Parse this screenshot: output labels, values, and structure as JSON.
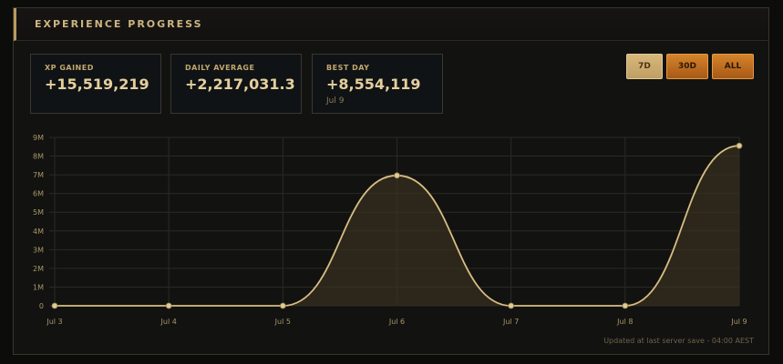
{
  "panel": {
    "title": "EXPERIENCE PROGRESS"
  },
  "stats": [
    {
      "label": "XP GAINED",
      "value": "+15,519,219"
    },
    {
      "label": "DAILY AVERAGE",
      "value": "+2,217,031.3"
    },
    {
      "label": "BEST DAY",
      "value": "+8,554,119",
      "sub": "Jul 9"
    }
  ],
  "range_buttons": {
    "active": "7D",
    "items": [
      "7D",
      "30D",
      "ALL"
    ]
  },
  "footer": {
    "note": "Updated at last server save - 04:00 AEST"
  },
  "colors": {
    "accent": "#cdb482",
    "line": "#d8bd83",
    "area": "#3a3320",
    "grid": "#2b2a25",
    "active_button": "#c9a96d",
    "button": "#c06e20"
  },
  "chart_data": {
    "type": "area",
    "categories": [
      "Jul 3",
      "Jul 4",
      "Jul 5",
      "Jul 6",
      "Jul 7",
      "Jul 8",
      "Jul 9"
    ],
    "series": [
      {
        "values": [
          0,
          0,
          0,
          6964970,
          0,
          0,
          8554119
        ]
      }
    ],
    "y_ticks": [
      "0",
      "1M",
      "2M",
      "3M",
      "4M",
      "5M",
      "6M",
      "7M",
      "8M",
      "9M"
    ],
    "ylim": [
      0,
      9000000
    ],
    "grid": true,
    "smooth": true
  }
}
